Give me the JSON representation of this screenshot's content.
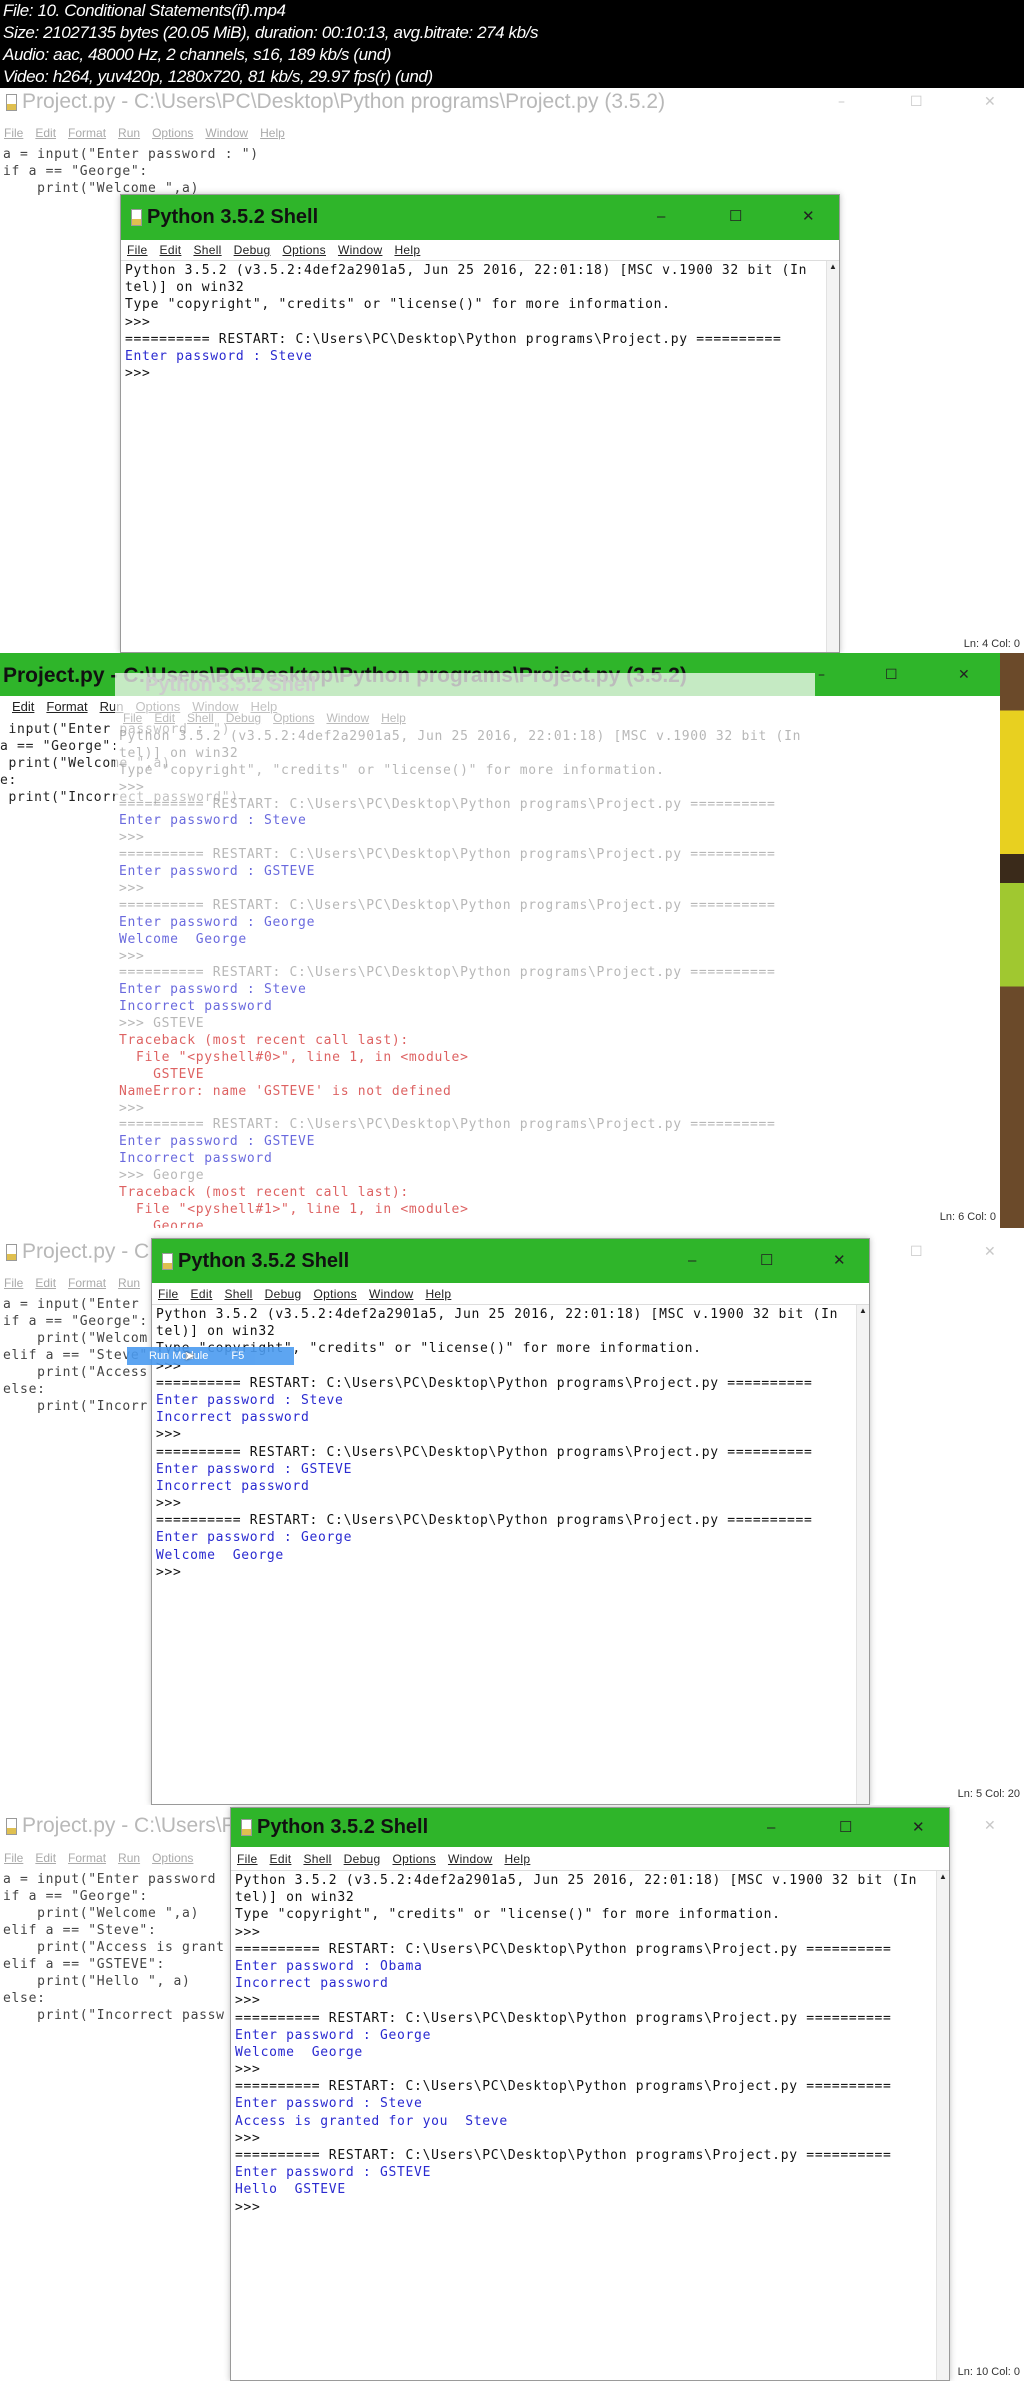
{
  "info": [
    "File: 10. Conditional Statements(if).mp4",
    "Size: 21027135 bytes (20.05 MiB), duration: 00:10:13, avg.bitrate: 274 kb/s",
    "Audio: aac, 48000 Hz, 2 channels, s16, 189 kb/s (und)",
    "Video: h264, yuv420p, 1280x720, 81 kb/s, 29.97 fps(r) (und)"
  ],
  "colors": {
    "titlebar_active": "#2fb52a",
    "output_text": "#2a2ad0",
    "error_text": "#d02020"
  },
  "editor": {
    "title": "Project.py - C:\\Users\\PC\\Desktop\\Python programs\\Project.py (3.5.2)",
    "title_short": "Project.py - C:\\Users\\PC\\Desktop\\Python programs\\Project.py (3.5.2)",
    "menu": [
      "File",
      "Edit",
      "Format",
      "Run",
      "Options",
      "Window",
      "Help"
    ],
    "minimize": "–",
    "maximize": "☐",
    "close": "✕"
  },
  "shell": {
    "title": "Python 3.5.2 Shell",
    "menu": [
      "File",
      "Edit",
      "Shell",
      "Debug",
      "Options",
      "Window",
      "Help"
    ],
    "minimize": "–",
    "maximize": "☐",
    "close": "✕"
  },
  "frames": [
    {
      "code": [
        "a = input(\"Enter password : \")",
        "if a == \"George\":",
        "    print(\"Welcome \",a)"
      ],
      "shell_lines": [
        {
          "text": "Python 3.5.2 (v3.5.2:4def2a2901a5, Jun 25 2016, 22:01:18) [MSC v.1900 32 bit (In",
          "kind": ""
        },
        {
          "text": "tel)] on win32",
          "kind": ""
        },
        {
          "text": "Type \"copyright\", \"credits\" or \"license()\" for more information.",
          "kind": ""
        },
        {
          "text": ">>> ",
          "kind": ""
        },
        {
          "text": "========== RESTART: C:\\Users\\PC\\Desktop\\Python programs\\Project.py ==========",
          "kind": ""
        },
        {
          "text": "Enter password : Steve",
          "kind": "k-in"
        },
        {
          "text": ">>> ",
          "kind": ""
        }
      ],
      "status": "Ln: 4  Col: 0"
    },
    {
      "code": [
        " input(\"Enter password : \")",
        "a == \"George\":",
        " print(\"Welcome \",a)",
        "e:",
        " print(\"Incorrect password\")"
      ],
      "shell_lines": [
        {
          "text": "Python 3.5.2 (v3.5.2:4def2a2901a5, Jun 25 2016, 22:01:18) [MSC v.1900 32 bit (In",
          "kind": ""
        },
        {
          "text": "tel)] on win32",
          "kind": ""
        },
        {
          "text": "Type \"copyright\", \"credits\" or \"license()\" for more information.",
          "kind": ""
        },
        {
          "text": ">>> ",
          "kind": ""
        },
        {
          "text": "========== RESTART: C:\\Users\\PC\\Desktop\\Python programs\\Project.py ==========",
          "kind": ""
        },
        {
          "text": "Enter password : Steve",
          "kind": "k-in"
        },
        {
          "text": ">>> ",
          "kind": ""
        },
        {
          "text": "========== RESTART: C:\\Users\\PC\\Desktop\\Python programs\\Project.py ==========",
          "kind": ""
        },
        {
          "text": "Enter password : GSTEVE",
          "kind": "k-in"
        },
        {
          "text": ">>> ",
          "kind": ""
        },
        {
          "text": "========== RESTART: C:\\Users\\PC\\Desktop\\Python programs\\Project.py ==========",
          "kind": ""
        },
        {
          "text": "Enter password : George",
          "kind": "k-in"
        },
        {
          "text": "Welcome  George",
          "kind": "k-out"
        },
        {
          "text": ">>> ",
          "kind": ""
        },
        {
          "text": "========== RESTART: C:\\Users\\PC\\Desktop\\Python programs\\Project.py ==========",
          "kind": ""
        },
        {
          "text": "Enter password : Steve",
          "kind": "k-in"
        },
        {
          "text": "Incorrect password",
          "kind": "k-out"
        },
        {
          "text": ">>> GSTEVE",
          "kind": ""
        },
        {
          "text": "Traceback (most recent call last):",
          "kind": "k-err"
        },
        {
          "text": "  File \"<pyshell#0>\", line 1, in <module>",
          "kind": "k-err"
        },
        {
          "text": "    GSTEVE",
          "kind": "k-err"
        },
        {
          "text": "NameError: name 'GSTEVE' is not defined",
          "kind": "k-err"
        },
        {
          "text": ">>> ",
          "kind": ""
        },
        {
          "text": "========== RESTART: C:\\Users\\PC\\Desktop\\Python programs\\Project.py ==========",
          "kind": ""
        },
        {
          "text": "Enter password : GSTEVE",
          "kind": "k-in"
        },
        {
          "text": "Incorrect password",
          "kind": "k-out"
        },
        {
          "text": ">>> George",
          "kind": ""
        },
        {
          "text": "Traceback (most recent call last):",
          "kind": "k-err"
        },
        {
          "text": "  File \"<pyshell#1>\", line 1, in <module>",
          "kind": "k-err"
        },
        {
          "text": "    George",
          "kind": "k-err"
        }
      ],
      "status": "Ln: 6  Col: 0"
    },
    {
      "code": [
        "a = input(\"Enter",
        "if a == \"George\":",
        "    print(\"Welcom",
        "elif a == \"Steve\"",
        "    print(\"Access",
        "else:",
        "    print(\"Incorr"
      ],
      "tooltip": {
        "label": "Run Module",
        "shortcut": "F5"
      },
      "shell_lines": [
        {
          "text": "Python 3.5.2 (v3.5.2:4def2a2901a5, Jun 25 2016, 22:01:18) [MSC v.1900 32 bit (In",
          "kind": ""
        },
        {
          "text": "tel)] on win32",
          "kind": ""
        },
        {
          "text": "Type \"copyright\", \"credits\" or \"license()\" for more information.",
          "kind": ""
        },
        {
          "text": ">>> ",
          "kind": ""
        },
        {
          "text": "========== RESTART: C:\\Users\\PC\\Desktop\\Python programs\\Project.py ==========",
          "kind": ""
        },
        {
          "text": "Enter password : Steve",
          "kind": "k-in"
        },
        {
          "text": "Incorrect password",
          "kind": "k-out"
        },
        {
          "text": ">>> ",
          "kind": ""
        },
        {
          "text": "========== RESTART: C:\\Users\\PC\\Desktop\\Python programs\\Project.py ==========",
          "kind": ""
        },
        {
          "text": "Enter password : GSTEVE",
          "kind": "k-in"
        },
        {
          "text": "Incorrect password",
          "kind": "k-out"
        },
        {
          "text": ">>> ",
          "kind": ""
        },
        {
          "text": "========== RESTART: C:\\Users\\PC\\Desktop\\Python programs\\Project.py ==========",
          "kind": ""
        },
        {
          "text": "Enter password : George",
          "kind": "k-in"
        },
        {
          "text": "Welcome  George",
          "kind": "k-out"
        },
        {
          "text": ">>> ",
          "kind": ""
        }
      ],
      "status": "Ln: 5  Col: 20"
    },
    {
      "code": [
        "a = input(\"Enter password",
        "if a == \"George\":",
        "    print(\"Welcome \",a)",
        "elif a == \"Steve\":",
        "    print(\"Access is grant",
        "elif a == \"GSTEVE\":",
        "    print(\"Hello \", a)",
        "else:",
        "    print(\"Incorrect passw"
      ],
      "shell_lines": [
        {
          "text": "Python 3.5.2 (v3.5.2:4def2a2901a5, Jun 25 2016, 22:01:18) [MSC v.1900 32 bit (In",
          "kind": ""
        },
        {
          "text": "tel)] on win32",
          "kind": ""
        },
        {
          "text": "Type \"copyright\", \"credits\" or \"license()\" for more information.",
          "kind": ""
        },
        {
          "text": ">>> ",
          "kind": ""
        },
        {
          "text": "========== RESTART: C:\\Users\\PC\\Desktop\\Python programs\\Project.py ==========",
          "kind": ""
        },
        {
          "text": "Enter password : Obama",
          "kind": "k-in"
        },
        {
          "text": "Incorrect password",
          "kind": "k-out"
        },
        {
          "text": ">>> ",
          "kind": ""
        },
        {
          "text": "========== RESTART: C:\\Users\\PC\\Desktop\\Python programs\\Project.py ==========",
          "kind": ""
        },
        {
          "text": "Enter password : George",
          "kind": "k-in"
        },
        {
          "text": "Welcome  George",
          "kind": "k-out"
        },
        {
          "text": ">>> ",
          "kind": ""
        },
        {
          "text": "========== RESTART: C:\\Users\\PC\\Desktop\\Python programs\\Project.py ==========",
          "kind": ""
        },
        {
          "text": "Enter password : Steve",
          "kind": "k-in"
        },
        {
          "text": "Access is granted for you  Steve",
          "kind": "k-out"
        },
        {
          "text": ">>> ",
          "kind": ""
        },
        {
          "text": "========== RESTART: C:\\Users\\PC\\Desktop\\Python programs\\Project.py ==========",
          "kind": ""
        },
        {
          "text": "Enter password : GSTEVE",
          "kind": "k-in"
        },
        {
          "text": "Hello  GSTEVE",
          "kind": "k-out"
        },
        {
          "text": ">>> ",
          "kind": ""
        }
      ],
      "status": "Ln: 10  Col: 0"
    }
  ]
}
